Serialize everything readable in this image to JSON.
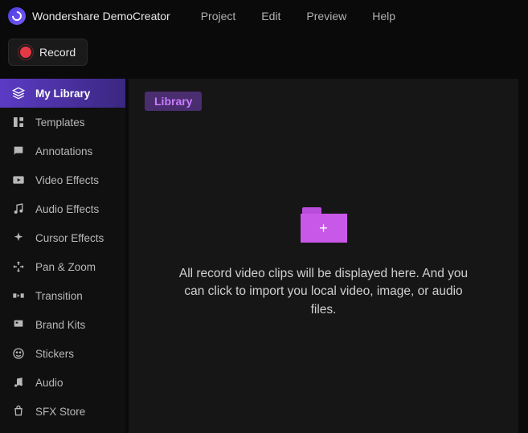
{
  "app": {
    "title": "Wondershare DemoCreator"
  },
  "menu": {
    "project": "Project",
    "edit": "Edit",
    "preview": "Preview",
    "help": "Help"
  },
  "record": {
    "label": "Record"
  },
  "sidebar": {
    "items": [
      {
        "label": "My Library",
        "icon": "layers-icon"
      },
      {
        "label": "Templates",
        "icon": "templates-icon"
      },
      {
        "label": "Annotations",
        "icon": "annotations-icon"
      },
      {
        "label": "Video Effects",
        "icon": "video-effects-icon"
      },
      {
        "label": "Audio Effects",
        "icon": "audio-effects-icon"
      },
      {
        "label": "Cursor Effects",
        "icon": "cursor-effects-icon"
      },
      {
        "label": "Pan & Zoom",
        "icon": "pan-zoom-icon"
      },
      {
        "label": "Transition",
        "icon": "transition-icon"
      },
      {
        "label": "Brand Kits",
        "icon": "brand-kits-icon"
      },
      {
        "label": "Stickers",
        "icon": "stickers-icon"
      },
      {
        "label": "Audio",
        "icon": "audio-icon"
      },
      {
        "label": "SFX Store",
        "icon": "sfx-store-icon"
      }
    ]
  },
  "content": {
    "badge": "Library",
    "empty_text": "All record video clips will be displayed here. And you can click to import you local video, image, or audio files.",
    "plus": "+"
  }
}
